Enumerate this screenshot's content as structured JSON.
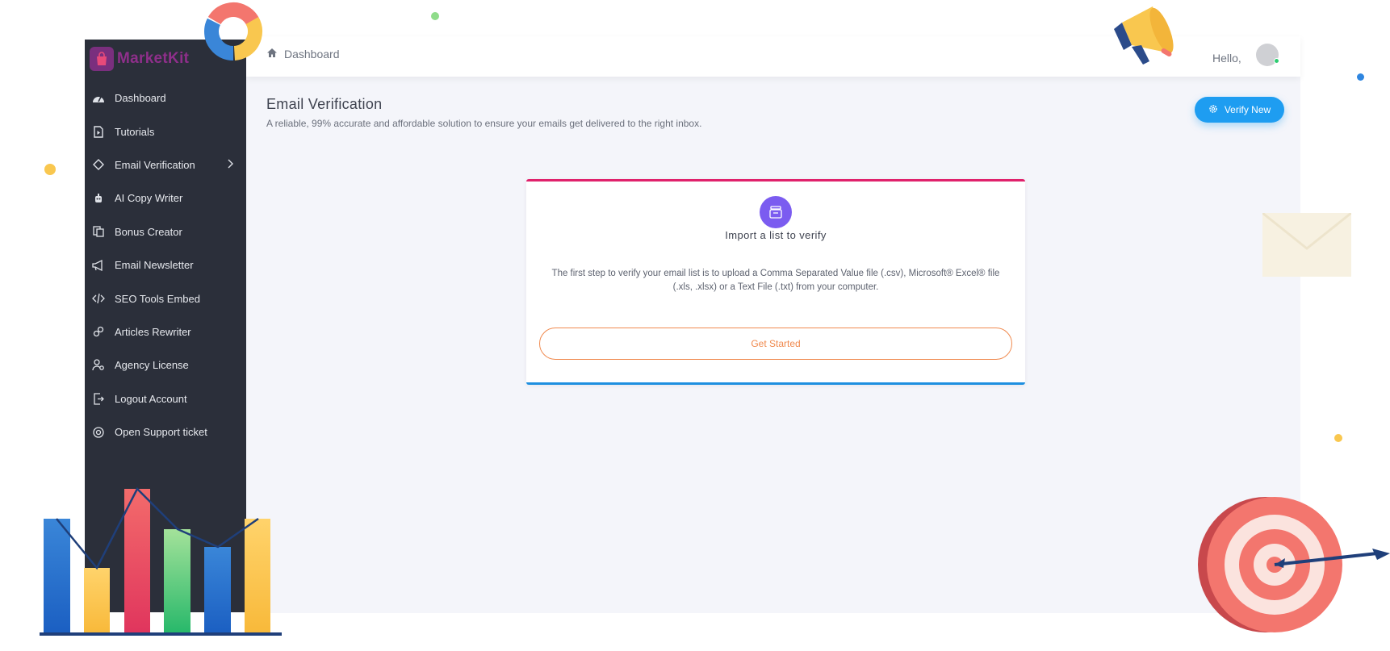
{
  "breadcrumb": {
    "label": "Dashboard"
  },
  "header": {
    "greeting": "Hello,"
  },
  "brand": {
    "name": "MarketKit"
  },
  "sidebar": {
    "items": [
      {
        "label": "Dashboard",
        "icon": "gauge-icon"
      },
      {
        "label": "Tutorials",
        "icon": "file-play-icon"
      },
      {
        "label": "Email Verification",
        "icon": "diamond-icon",
        "has_submenu": true
      },
      {
        "label": "AI Copy Writer",
        "icon": "robot-icon"
      },
      {
        "label": "Bonus Creator",
        "icon": "copy-icon"
      },
      {
        "label": "Email Newsletter",
        "icon": "megaphone-icon"
      },
      {
        "label": "SEO Tools Embed",
        "icon": "code-icon"
      },
      {
        "label": "Articles Rewriter",
        "icon": "link-icon"
      },
      {
        "label": "Agency License",
        "icon": "user-search-icon"
      },
      {
        "label": "Logout Account",
        "icon": "logout-icon"
      },
      {
        "label": "Open Support ticket",
        "icon": "lifebuoy-icon"
      }
    ]
  },
  "page": {
    "title": "Email Verification",
    "subtitle": "A reliable, 99% accurate and affordable solution to ensure your emails get delivered to the right inbox.",
    "verify_button": "Verify New"
  },
  "card": {
    "title": "Import a list to verify",
    "description": "The first step to verify your email list is to upload a Comma Separated Value file (.csv), Microsoft® Excel® file (.xls, .xlsx) or a Text File (.txt) from your computer.",
    "button": "Get Started"
  },
  "colors": {
    "sidebar_bg": "#2b2f3a",
    "accent_blue": "#1e9df1",
    "card_top_border": "#e0216b",
    "card_bottom_border": "#1e8fe0",
    "get_started": "#f08a4f",
    "import_icon_bg": "#7b5cf0"
  }
}
